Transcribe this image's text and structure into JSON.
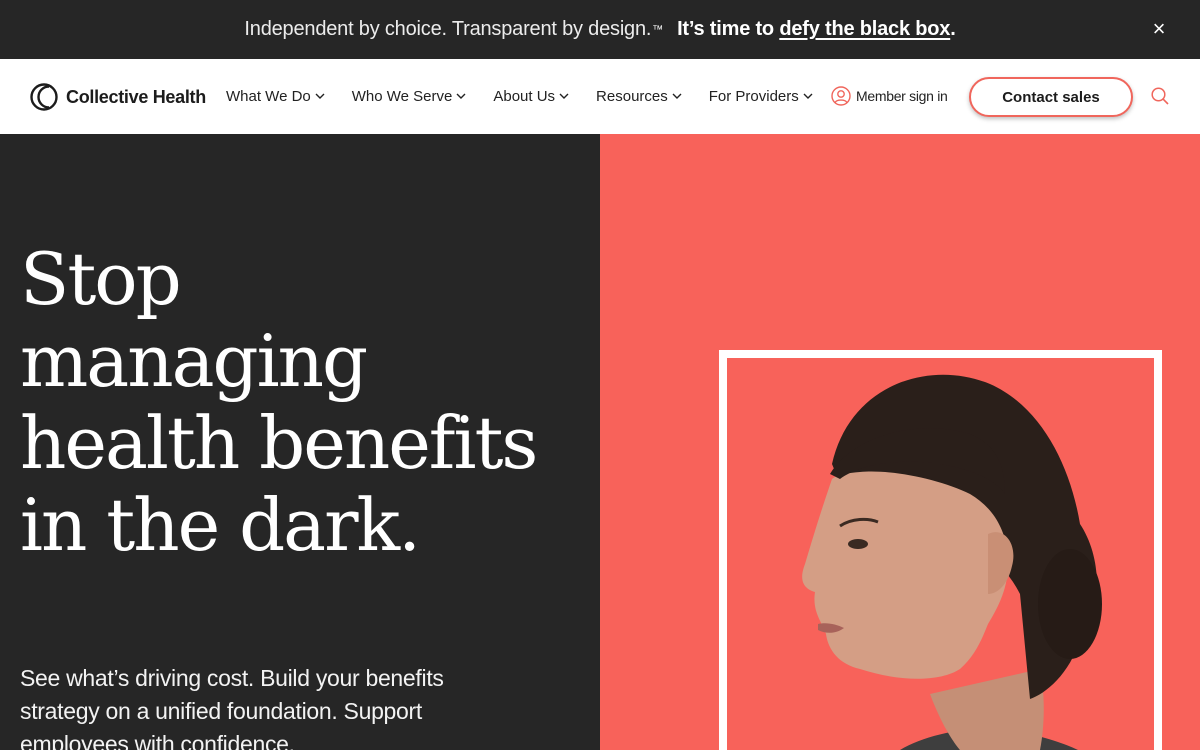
{
  "announcement": {
    "text": "Independent by choice. Transparent by design.",
    "trademark": "™",
    "cta_prefix": "It’s time to ",
    "cta_link": "defy the black box",
    "cta_suffix": ".",
    "close_label": "×"
  },
  "nav": {
    "logo_name": "Collective Health",
    "items": [
      {
        "label": "What We Do"
      },
      {
        "label": "Who We Serve"
      },
      {
        "label": "About Us"
      },
      {
        "label": "Resources"
      },
      {
        "label": "For Providers"
      }
    ],
    "member_sign_in": "Member sign in",
    "contact_sales": "Contact sales"
  },
  "hero": {
    "title": "Stop managing health benefits in the dark.",
    "subtitle": "See what’s driving cost. Build your benefits strategy on a unified foundation. Support employees with confidence."
  },
  "colors": {
    "dark": "#262626",
    "coral": "#f8625a",
    "accent": "#f0665c",
    "white": "#ffffff"
  },
  "icons": [
    "logo-icon",
    "chevron-down-icon",
    "user-circle-icon",
    "search-icon",
    "close-icon"
  ]
}
